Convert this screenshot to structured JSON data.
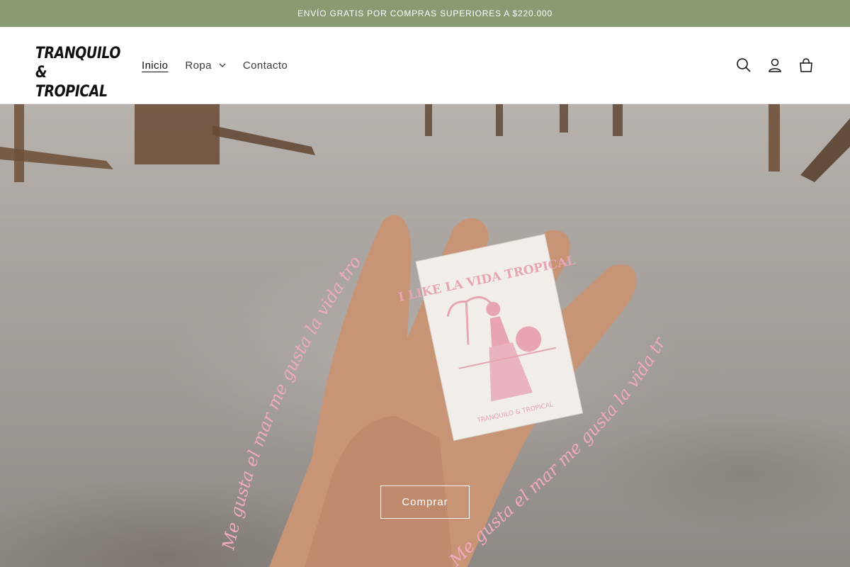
{
  "announcement": {
    "text": "ENVÍO GRATIS POR COMPRAS SUPERIORES A $220.000"
  },
  "brand": {
    "line1": "TRANQUILO",
    "line2": "& TROPICAL"
  },
  "nav": {
    "items": [
      {
        "label": "Inicio",
        "active": true
      },
      {
        "label": "Ropa",
        "has_dropdown": true
      },
      {
        "label": "Contacto"
      }
    ]
  },
  "header_icons": [
    "search-icon",
    "account-icon",
    "cart-icon"
  ],
  "hero": {
    "card_text": {
      "main": "I LIKE LA VIDA TROPICAL",
      "footer": "TRANQUILO & TROPICAL"
    },
    "script_text_1": "Me gusta el mar me gusta la vida tropical",
    "script_text_2": "Me gusta el mar me gusta la vida tropical",
    "cta_label": "Comprar"
  },
  "colors": {
    "announcement_bg": "#8a9a72",
    "card_ink": "#e7a5b4",
    "text": "#121212"
  }
}
